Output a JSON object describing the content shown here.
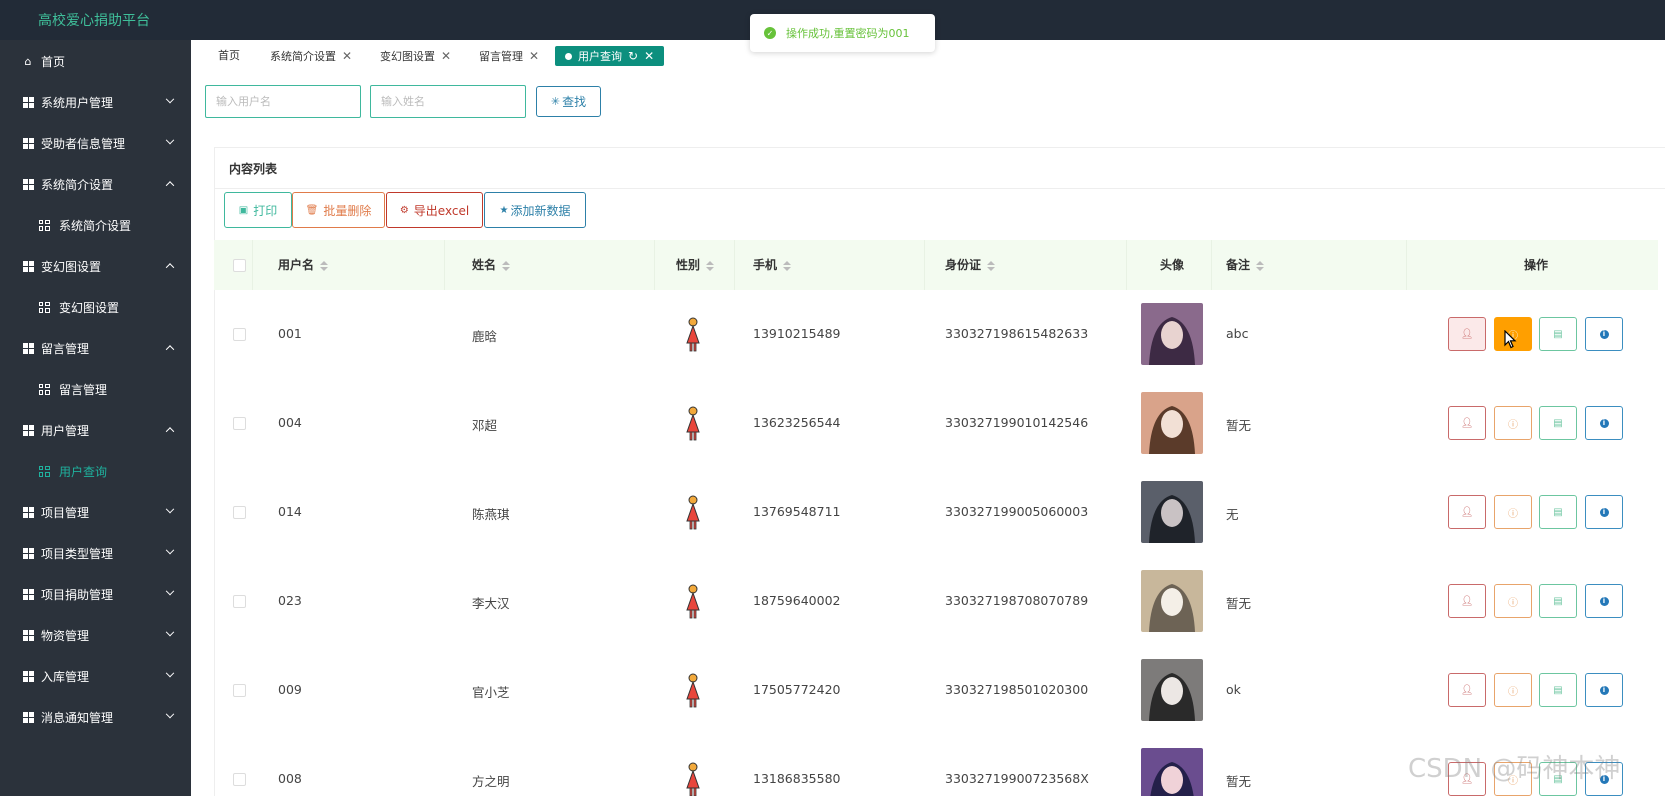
{
  "app": {
    "title": "高校爱心捐助平台"
  },
  "toast": {
    "text": "操作成功,重置密码为001",
    "color": "#67c23a"
  },
  "sidebar": {
    "items": [
      {
        "label": "首页",
        "icon": "home-icon",
        "type": "top"
      },
      {
        "label": "系统用户管理",
        "icon": "grid-icon",
        "type": "group",
        "expanded": false
      },
      {
        "label": "受助者信息管理",
        "icon": "grid-icon",
        "type": "group",
        "expanded": false
      },
      {
        "label": "系统简介设置",
        "icon": "grid-icon",
        "type": "group",
        "expanded": true
      },
      {
        "label": "系统简介设置",
        "icon": "apps-icon",
        "type": "sub"
      },
      {
        "label": "变幻图设置",
        "icon": "grid-icon",
        "type": "group",
        "expanded": true
      },
      {
        "label": "变幻图设置",
        "icon": "apps-icon",
        "type": "sub"
      },
      {
        "label": "留言管理",
        "icon": "grid-icon",
        "type": "group",
        "expanded": true
      },
      {
        "label": "留言管理",
        "icon": "apps-icon",
        "type": "sub"
      },
      {
        "label": "用户管理",
        "icon": "grid-icon",
        "type": "group",
        "expanded": true
      },
      {
        "label": "用户查询",
        "icon": "apps-icon",
        "type": "sub",
        "active": true
      },
      {
        "label": "项目管理",
        "icon": "grid-icon",
        "type": "group",
        "expanded": false
      },
      {
        "label": "项目类型管理",
        "icon": "grid-icon",
        "type": "group",
        "expanded": false
      },
      {
        "label": "项目捐助管理",
        "icon": "grid-icon",
        "type": "group",
        "expanded": false
      },
      {
        "label": "物资管理",
        "icon": "grid-icon",
        "type": "group",
        "expanded": false
      },
      {
        "label": "入库管理",
        "icon": "grid-icon",
        "type": "group",
        "expanded": false
      },
      {
        "label": "消息通知管理",
        "icon": "grid-icon",
        "type": "group",
        "expanded": false
      }
    ]
  },
  "tabs": [
    {
      "label": "首页",
      "closable": false
    },
    {
      "label": "系统简介设置",
      "closable": true
    },
    {
      "label": "变幻图设置",
      "closable": true
    },
    {
      "label": "留言管理",
      "closable": true
    },
    {
      "label": "用户查询",
      "closable": true,
      "current": true
    }
  ],
  "search": {
    "username_placeholder": "输入用户名",
    "name_placeholder": "输入姓名",
    "button_label": "查找"
  },
  "panel": {
    "title": "内容列表"
  },
  "actions": {
    "print": "打印",
    "batch_delete": "批量删除",
    "export": "导出excel",
    "add": "添加新数据"
  },
  "table": {
    "columns": {
      "username": "用户名",
      "name": "姓名",
      "gender": "性别",
      "phone": "手机",
      "idcard": "身份证",
      "avatar": "头像",
      "remark": "备注",
      "ops": "操作"
    },
    "rows": [
      {
        "username": "001",
        "name": "鹿晗",
        "phone": "13910215489",
        "idcard": "330327198615482633",
        "remark": "abc"
      },
      {
        "username": "004",
        "name": "邓超",
        "phone": "13623256544",
        "idcard": "330327199010142546",
        "remark": "暂无"
      },
      {
        "username": "014",
        "name": "陈燕琪",
        "phone": "13769548711",
        "idcard": "330327199005060003",
        "remark": "无"
      },
      {
        "username": "023",
        "name": "李大汉",
        "phone": "18759640002",
        "idcard": "330327198708070789",
        "remark": "暂无"
      },
      {
        "username": "009",
        "name": "官小芝",
        "phone": "17505772420",
        "idcard": "330327198501020300",
        "remark": "ok"
      },
      {
        "username": "008",
        "name": "方之明",
        "phone": "13186835580",
        "idcard": "33032719900723568X",
        "remark": "暂无"
      }
    ]
  },
  "watermark": "CSDN @码神本神"
}
